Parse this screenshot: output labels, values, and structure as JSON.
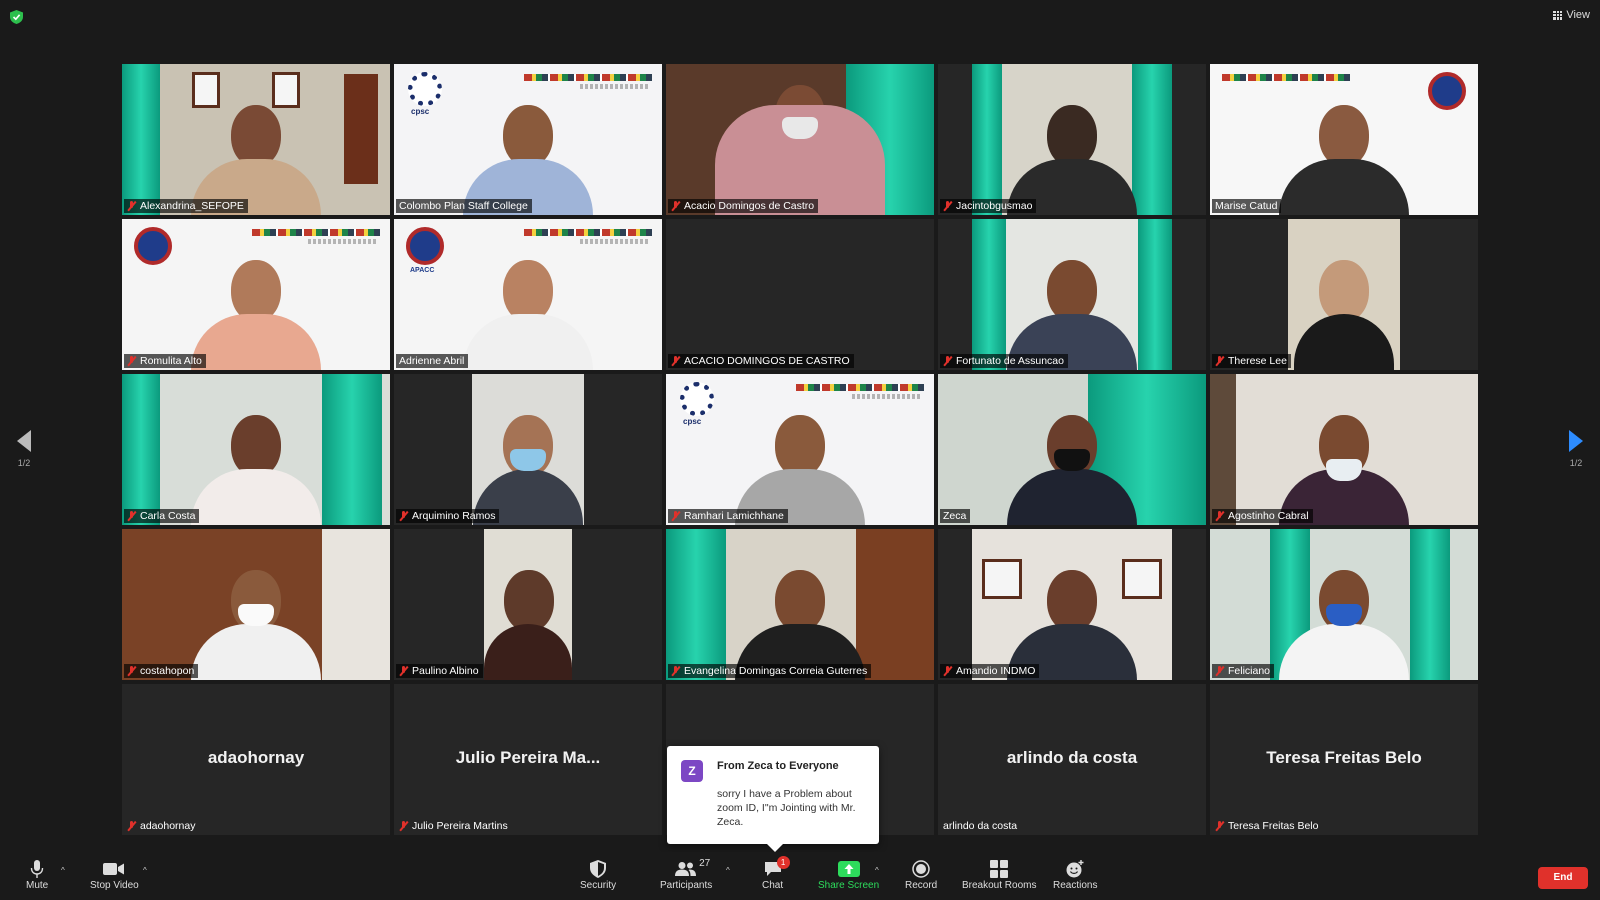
{
  "top_bar": {
    "view_label": "View"
  },
  "pager": {
    "left": "1/2",
    "right": "1/2"
  },
  "tiles": [
    {
      "name": "Alexandrina_SEFOPE"
    },
    {
      "name": "Colombo Plan Staff College",
      "logo_text": "cpsc"
    },
    {
      "name": "Acacio Domingos de Castro"
    },
    {
      "name": "Jacintobgusmao"
    },
    {
      "name": "Marise Catud"
    },
    {
      "name": "Romulita Alto"
    },
    {
      "name": "Adrienne Abril",
      "logo_text": "APACC"
    },
    {
      "name": "ACACIO DOMINGOS DE CASTRO"
    },
    {
      "name": "Fortunato de Assuncao"
    },
    {
      "name": "Therese Lee"
    },
    {
      "name": "Carla Costa"
    },
    {
      "name": "Arquimino Ramos"
    },
    {
      "name": "Ramhari Lamichhane",
      "logo_text": "cpsc"
    },
    {
      "name": "Zeca"
    },
    {
      "name": "Agostinho Cabral"
    },
    {
      "name": "costahopon"
    },
    {
      "name": "Paulino Albino"
    },
    {
      "name": "Evangelina Domingas Correia Guterres"
    },
    {
      "name": "Amandio INDMO"
    },
    {
      "name": "Feliciano"
    },
    {
      "name": "adaohornay",
      "display": "adaohornay"
    },
    {
      "name": "Julio Pereira Martins",
      "display": "Julio Pereira Ma..."
    },
    {
      "name": "",
      "display": ""
    },
    {
      "name": "arlindo da costa",
      "display": "arlindo da costa"
    },
    {
      "name": "Teresa Freitas Belo",
      "display": "Teresa Freitas Belo"
    }
  ],
  "chat_popup": {
    "avatar_letter": "Z",
    "from": "From Zeca to Everyone",
    "message": "sorry I have a Problem about zoom ID, I\"m Jointing with Mr. Zeca."
  },
  "toolbar": {
    "mute": "Mute",
    "stop_video": "Stop Video",
    "security": "Security",
    "participants": "Participants",
    "participants_count": "27",
    "chat": "Chat",
    "chat_badge": "1",
    "share_screen": "Share Screen",
    "record": "Record",
    "breakout_rooms": "Breakout Rooms",
    "reactions": "Reactions",
    "end": "End"
  },
  "colors": {
    "active_speaker": "#d8f55c",
    "end": "#e0312b",
    "share": "#2ddc5c",
    "muted": "#e0312b"
  }
}
